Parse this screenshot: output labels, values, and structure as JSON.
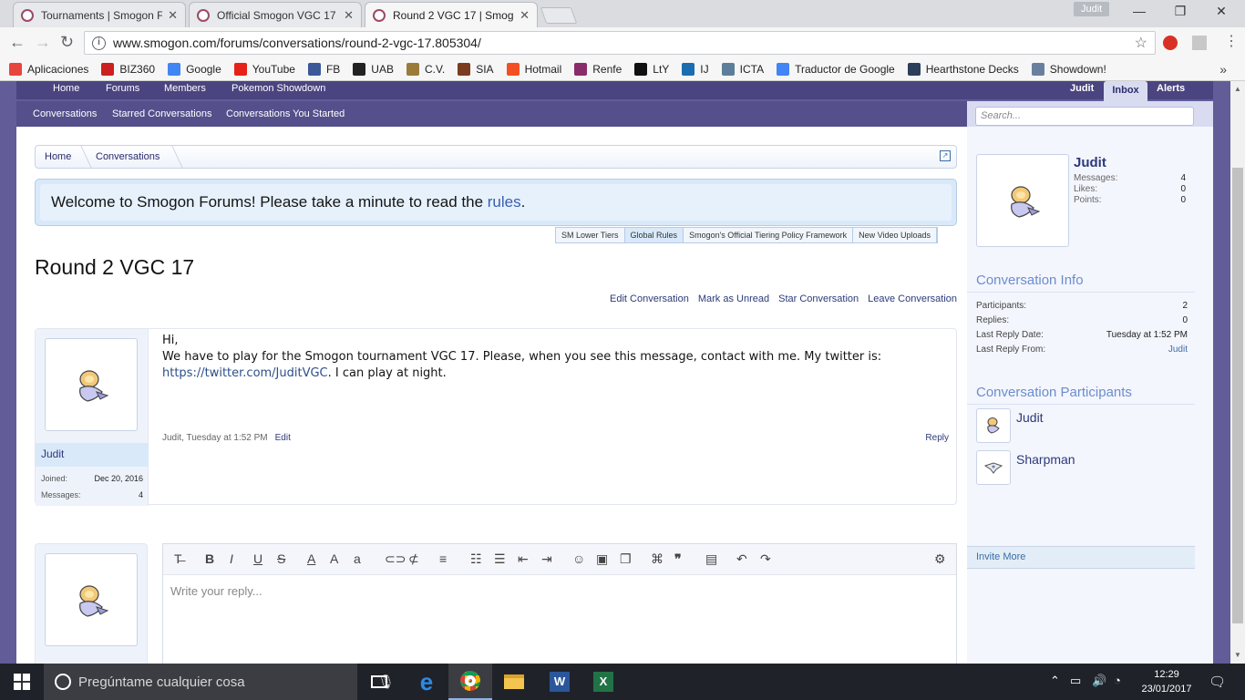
{
  "browser": {
    "tabs": [
      {
        "title": "Tournaments | Smogon F",
        "active": false
      },
      {
        "title": "Official Smogon VGC 17",
        "active": false
      },
      {
        "title": "Round 2 VGC 17 | Smog",
        "active": true
      }
    ],
    "user_chip": "Judit",
    "url": "www.smogon.com/forums/conversations/round-2-vgc-17.805304/",
    "bookmarks": [
      {
        "label": "Aplicaciones",
        "color": "#e8453c"
      },
      {
        "label": "BIZ360",
        "color": "#cc1f1f"
      },
      {
        "label": "Google",
        "color": "#4285f4"
      },
      {
        "label": "YouTube",
        "color": "#e62117"
      },
      {
        "label": "FB",
        "color": "#3b5998"
      },
      {
        "label": "UAB",
        "color": "#222222"
      },
      {
        "label": "C.V.",
        "color": "#9b7b3a"
      },
      {
        "label": "SIA",
        "color": "#7a3b1e"
      },
      {
        "label": "Hotmail",
        "color": "#f25022"
      },
      {
        "label": "Renfe",
        "color": "#8a2c6b"
      },
      {
        "label": "LtY",
        "color": "#111111"
      },
      {
        "label": "IJ",
        "color": "#1b6db0"
      },
      {
        "label": "ICTA",
        "color": "#5d7e9a"
      },
      {
        "label": "Traductor de Google",
        "color": "#4285f4"
      },
      {
        "label": "Hearthstone Decks",
        "color": "#2c3e5a"
      },
      {
        "label": "Showdown!",
        "color": "#6a7f9f"
      }
    ]
  },
  "forum": {
    "nav_primary": [
      "Home",
      "Forums",
      "Members",
      "Pokemon Showdown"
    ],
    "nav_user": "Judit",
    "nav_inbox": "Inbox",
    "nav_alerts": "Alerts",
    "nav_secondary": [
      "Conversations",
      "Starred Conversations",
      "Conversations You Started"
    ],
    "search_placeholder": "Search...",
    "breadcrumb": [
      "Home",
      "Conversations"
    ],
    "notice_text": "Welcome to Smogon Forums! Please take a minute to read the ",
    "notice_link": "rules",
    "notice_end": ".",
    "rule_tabs": [
      "SM Lower Tiers",
      "Global Rules",
      "Smogon's Official Tiering Policy Framework",
      "New Video Uploads"
    ],
    "title": "Round 2 VGC 17",
    "conv_links": [
      "Edit Conversation",
      "Mark as Unread",
      "Star Conversation",
      "Leave Conversation"
    ],
    "message": {
      "author": "Judit",
      "joined_label": "Joined:",
      "joined": "Dec 20, 2016",
      "messages_label": "Messages:",
      "messages": "4",
      "line1": "Hi,",
      "line2": "We have to play for the Smogon tournament VGC 17. Please, when you see this message, contact with me. My twitter is:",
      "link": "https://twitter.com/JuditVGC",
      "line3": ". I can play at night.",
      "footer": "Judit, Tuesday at 1:52 PM",
      "edit": "Edit",
      "reply": "Reply"
    },
    "reply_placeholder": "Write your reply..."
  },
  "sidebar": {
    "visitor": {
      "name": "Judit",
      "stats": [
        {
          "label": "Messages:",
          "value": "4"
        },
        {
          "label": "Likes:",
          "value": "0"
        },
        {
          "label": "Points:",
          "value": "0"
        }
      ]
    },
    "info_title": "Conversation Info",
    "info": [
      {
        "label": "Participants:",
        "value": "2"
      },
      {
        "label": "Replies:",
        "value": "0"
      },
      {
        "label": "Last Reply Date:",
        "value": "Tuesday at 1:52 PM"
      },
      {
        "label": "Last Reply From:",
        "value": "Judit"
      }
    ],
    "participants_title": "Conversation Participants",
    "participants": [
      "Judit",
      "Sharpman"
    ],
    "invite": "Invite More"
  },
  "taskbar": {
    "search": "Pregúntame cualquier cosa",
    "time": "12:29",
    "date": "23/01/2017"
  }
}
